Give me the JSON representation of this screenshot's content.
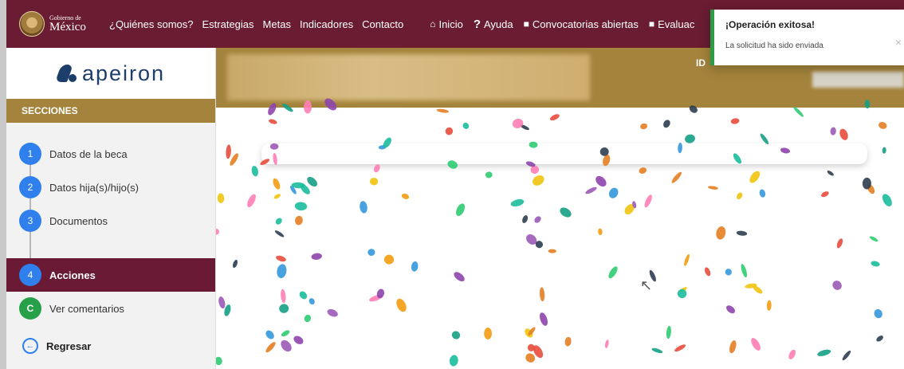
{
  "header": {
    "logo_small": "Gobierno de",
    "logo_big": "México",
    "nav": [
      "¿Quiénes somos?",
      "Estrategias",
      "Metas",
      "Indicadores",
      "Contacto"
    ],
    "right_links": [
      {
        "icon": "home-icon",
        "label": "Inicio"
      },
      {
        "icon": "help-icon",
        "label": "Ayuda"
      },
      {
        "icon": "book-icon",
        "label": "Convocatorias abiertas"
      },
      {
        "icon": "book-icon",
        "label": "Evaluac"
      }
    ]
  },
  "sidebar": {
    "brand": "apeiron",
    "section_title": "SECCIONES",
    "steps": [
      {
        "number": "1",
        "label": "Datos de la beca"
      },
      {
        "number": "2",
        "label": "Datos hija(s)/hijo(s)"
      },
      {
        "number": "3",
        "label": "Documentos"
      },
      {
        "number": "4",
        "label": "Acciones"
      },
      {
        "number": "C",
        "label": "Ver comentarios"
      }
    ],
    "back_label": "Regresar"
  },
  "main": {
    "id_label": "ID"
  },
  "toast": {
    "title": "¡Operación exitosa!",
    "message": "La solicitud ha sido enviada",
    "close": "×"
  },
  "colors": {
    "header": "#691c32",
    "gold": "#a4843c",
    "step_blue": "#2f80ed",
    "success": "#2e9b47",
    "active_step": "#6a1a34"
  }
}
